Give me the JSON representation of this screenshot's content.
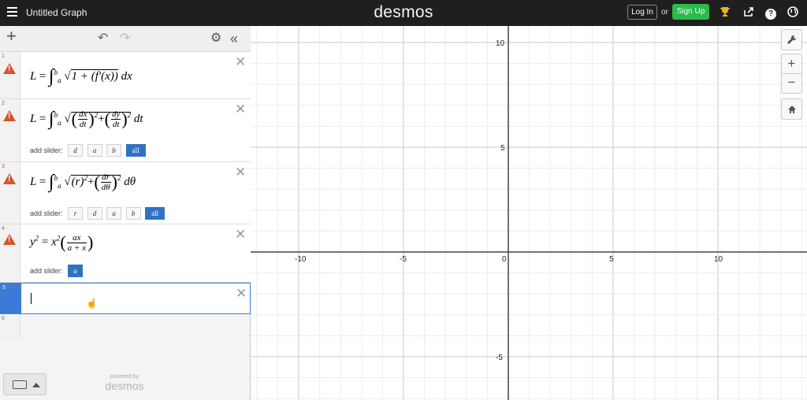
{
  "header": {
    "title": "Untitled Graph",
    "brand": "desmos",
    "login_label": "Log In",
    "or_label": "or",
    "signup_label": "Sign Up"
  },
  "toolbar": {
    "add_glyph": "+",
    "undo_glyph": "↶",
    "redo_glyph": "↷",
    "settings_glyph": "⚙",
    "collapse_glyph": "«"
  },
  "expressions": [
    {
      "index": "1",
      "lhs": "L",
      "eq": "=",
      "int_sign": "∫",
      "upper": "b",
      "lower": "a",
      "radical": "√",
      "body": "1 + (f′(x))",
      "tail": "dx"
    },
    {
      "index": "2",
      "lhs": "L",
      "eq": "=",
      "int_sign": "∫",
      "upper": "b",
      "lower": "a",
      "radical": "√",
      "frac1_num": "dx",
      "frac1_den": "dt",
      "frac2_num": "dy",
      "frac2_den": "dt",
      "exp": "2",
      "plus": "+",
      "tail": "dt",
      "slider_label": "add slider:",
      "sliders": [
        "d",
        "a",
        "b",
        "all"
      ]
    },
    {
      "index": "3",
      "lhs": "L",
      "eq": "=",
      "int_sign": "∫",
      "upper": "b",
      "lower": "a",
      "radical": "√",
      "term": "(r)",
      "frac_num": "dr",
      "frac_den": "dθ",
      "exp": "2",
      "plus": "+",
      "tail": "dθ",
      "slider_label": "add slider:",
      "sliders": [
        "r",
        "d",
        "a",
        "b",
        "all"
      ]
    },
    {
      "index": "4",
      "lhs": "y",
      "exp": "2",
      "eq": "=",
      "rhs": "x",
      "frac_num": "ax",
      "frac_den": "a + x",
      "slider_label": "add slider:",
      "sliders": [
        "a"
      ]
    },
    {
      "index": "5",
      "value": ""
    },
    {
      "index": "6"
    }
  ],
  "delete_glyph": "✕",
  "footer": {
    "powered_by": "powered by",
    "brand": "desmos"
  },
  "graph": {
    "x_ticks": [
      "-10",
      "-5",
      "0",
      "5",
      "10"
    ],
    "y_ticks": [
      "10",
      "5",
      "-5"
    ],
    "x_range": [
      -12,
      14
    ],
    "y_range": [
      -7,
      10.5
    ],
    "grid": true
  },
  "graph_controls": {
    "wrench_glyph": "🔧",
    "zoom_in_glyph": "+",
    "zoom_out_glyph": "−",
    "home_glyph": "⌂"
  },
  "icons": [
    "hamburger-icon",
    "trophy-icon",
    "share-icon",
    "help-icon",
    "globe-icon",
    "warning-icon",
    "keyboard-icon"
  ],
  "colors": {
    "topbar": "#1f1f1f",
    "signup": "#2bbb4a",
    "warning": "#d4562b",
    "accent": "#2f72c4"
  }
}
